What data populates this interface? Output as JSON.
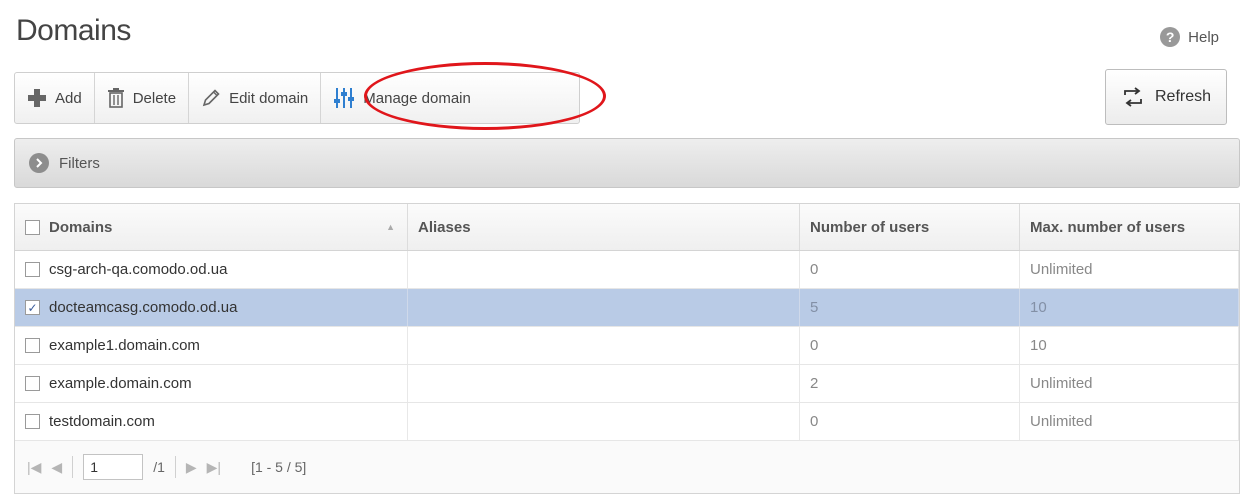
{
  "page": {
    "title": "Domains"
  },
  "help": {
    "label": "Help",
    "icon": "question-icon"
  },
  "toolbar": {
    "add_label": "Add",
    "delete_label": "Delete",
    "edit_label": "Edit domain",
    "manage_label": "Manage domain"
  },
  "refresh": {
    "label": "Refresh"
  },
  "filters": {
    "label": "Filters"
  },
  "grid": {
    "columns": [
      "Domains",
      "Aliases",
      "Number of users",
      "Max. number of users"
    ],
    "rows": [
      {
        "domain": "csg-arch-qa.comodo.od.ua",
        "aliases": "",
        "users": "0",
        "max_users": "Unlimited",
        "checked": false
      },
      {
        "domain": "docteamcasg.comodo.od.ua",
        "aliases": "",
        "users": "5",
        "max_users": "10",
        "checked": true
      },
      {
        "domain": "example1.domain.com",
        "aliases": "",
        "users": "0",
        "max_users": "10",
        "checked": false
      },
      {
        "domain": "example.domain.com",
        "aliases": "",
        "users": "2",
        "max_users": "Unlimited",
        "checked": false
      },
      {
        "domain": "testdomain.com",
        "aliases": "",
        "users": "0",
        "max_users": "Unlimited",
        "checked": false
      }
    ]
  },
  "pager": {
    "page_value": "1",
    "page_total": "/1",
    "range": "[1 - 5 / 5]"
  },
  "colors": {
    "selected_row": "#b9cbe6",
    "annotation": "#e0161b",
    "manage_icon": "#2f7fd0"
  }
}
